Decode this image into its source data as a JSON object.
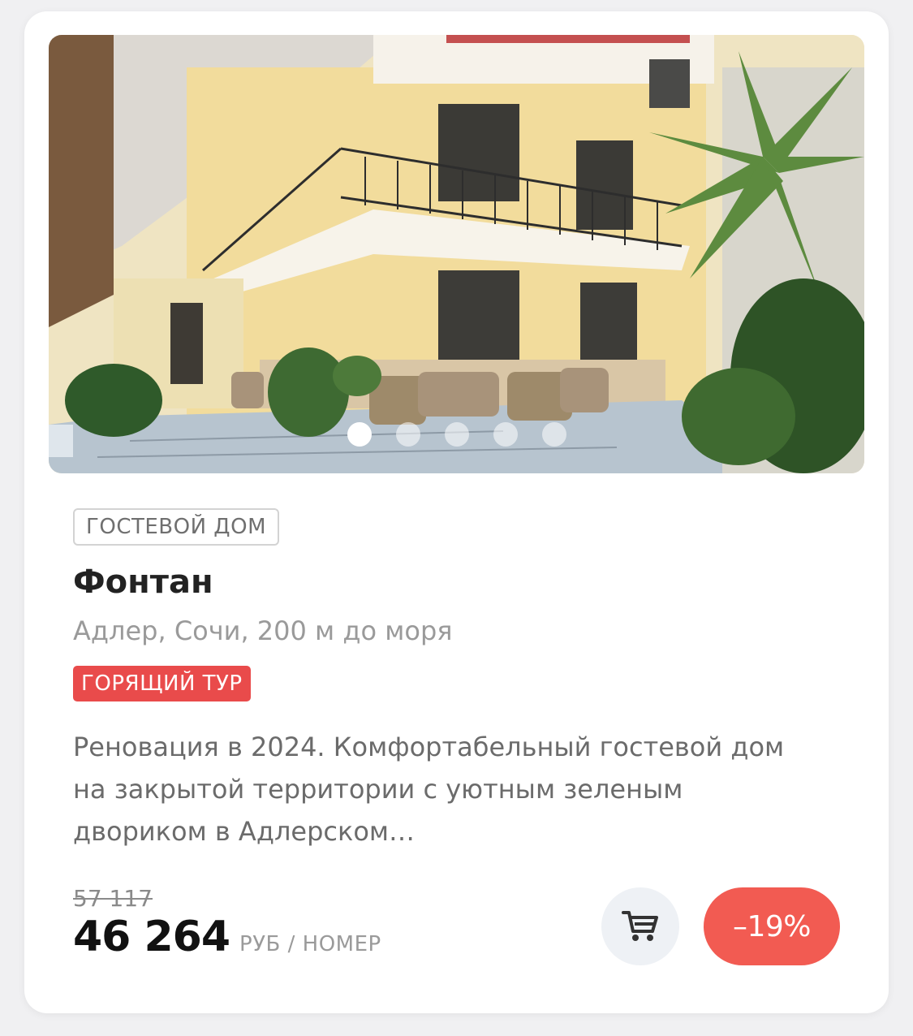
{
  "card": {
    "photo": {
      "subject": "photo",
      "carousel_dots": 5,
      "active_index": 0
    },
    "property_type": "ГОСТЕВОЙ ДОМ",
    "name": "Фонтан",
    "location": "Адлер, Сочи, 200 м до моря",
    "badge": "ГОРЯЩИЙ ТУР",
    "description": "Реновация в 2024. Комфортабельный гостевой дом на закрытой территории с уютным зеленым двориком в Адлерском…",
    "old_price": "57 117",
    "price": "46 264",
    "price_unit": "РУБ / НОМЕР",
    "discount": "–19%",
    "cart_icon": "cart-icon"
  },
  "colors": {
    "badge_bg": "#e94b4b",
    "discount_bg": "#f25b52",
    "cart_bg": "#eef1f5"
  }
}
